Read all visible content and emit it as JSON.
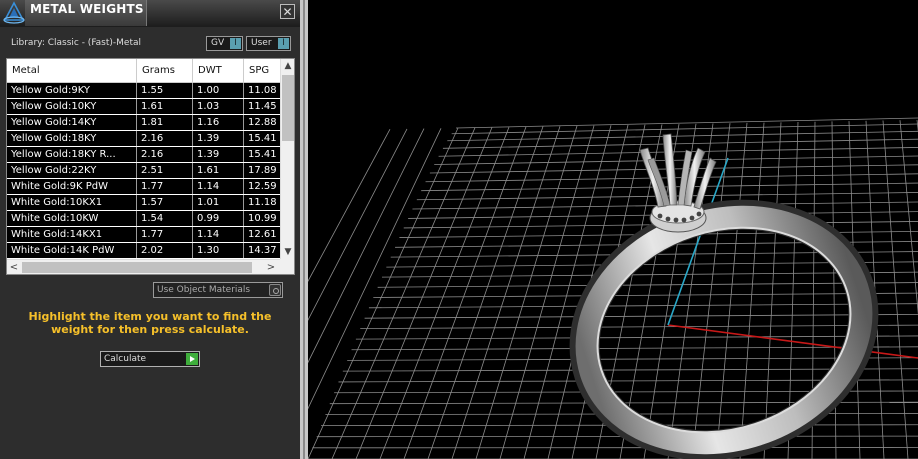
{
  "window": {
    "title": "METAL WEIGHTS",
    "close_glyph": "✕"
  },
  "library": {
    "label": "Library: Classic - (Fast)-Metal",
    "toggles": [
      {
        "label": "GV",
        "knob": "I"
      },
      {
        "label": "User",
        "knob": "I"
      }
    ]
  },
  "table": {
    "columns": [
      "Metal",
      "Grams",
      "DWT",
      "SPG"
    ],
    "rows": [
      {
        "metal": "Yellow Gold:9KY",
        "grams": "1.55",
        "dwt": "1.00",
        "spg": "11.08"
      },
      {
        "metal": "Yellow Gold:10KY",
        "grams": "1.61",
        "dwt": "1.03",
        "spg": "11.45"
      },
      {
        "metal": "Yellow Gold:14KY",
        "grams": "1.81",
        "dwt": "1.16",
        "spg": "12.88"
      },
      {
        "metal": "Yellow Gold:18KY",
        "grams": "2.16",
        "dwt": "1.39",
        "spg": "15.41"
      },
      {
        "metal": "Yellow Gold:18KY R...",
        "grams": "2.16",
        "dwt": "1.39",
        "spg": "15.41"
      },
      {
        "metal": "Yellow Gold:22KY",
        "grams": "2.51",
        "dwt": "1.61",
        "spg": "17.89"
      },
      {
        "metal": "White Gold:9K PdW",
        "grams": "1.77",
        "dwt": "1.14",
        "spg": "12.59"
      },
      {
        "metal": "White Gold:10KX1",
        "grams": "1.57",
        "dwt": "1.01",
        "spg": "11.18"
      },
      {
        "metal": "White Gold:10KW",
        "grams": "1.54",
        "dwt": "0.99",
        "spg": "10.99"
      },
      {
        "metal": "White Gold:14KX1",
        "grams": "1.77",
        "dwt": "1.14",
        "spg": "12.61"
      },
      {
        "metal": "White Gold:14K PdW",
        "grams": "2.02",
        "dwt": "1.30",
        "spg": "14.37"
      }
    ],
    "scroll_up": "▲",
    "scroll_down": "▼",
    "scroll_left": "<",
    "scroll_right": ">"
  },
  "controls": {
    "use_object_materials": "Use Object Materials",
    "hint": "Highlight the item you want to find the weight for then press calculate.",
    "calculate": "Calculate"
  },
  "viewport": {
    "background": "#000000",
    "grid_color": "#8c8c8c",
    "x_axis_color": "#c81818",
    "z_axis_color": "#2aa8c8",
    "object": "solitaire-ring"
  }
}
